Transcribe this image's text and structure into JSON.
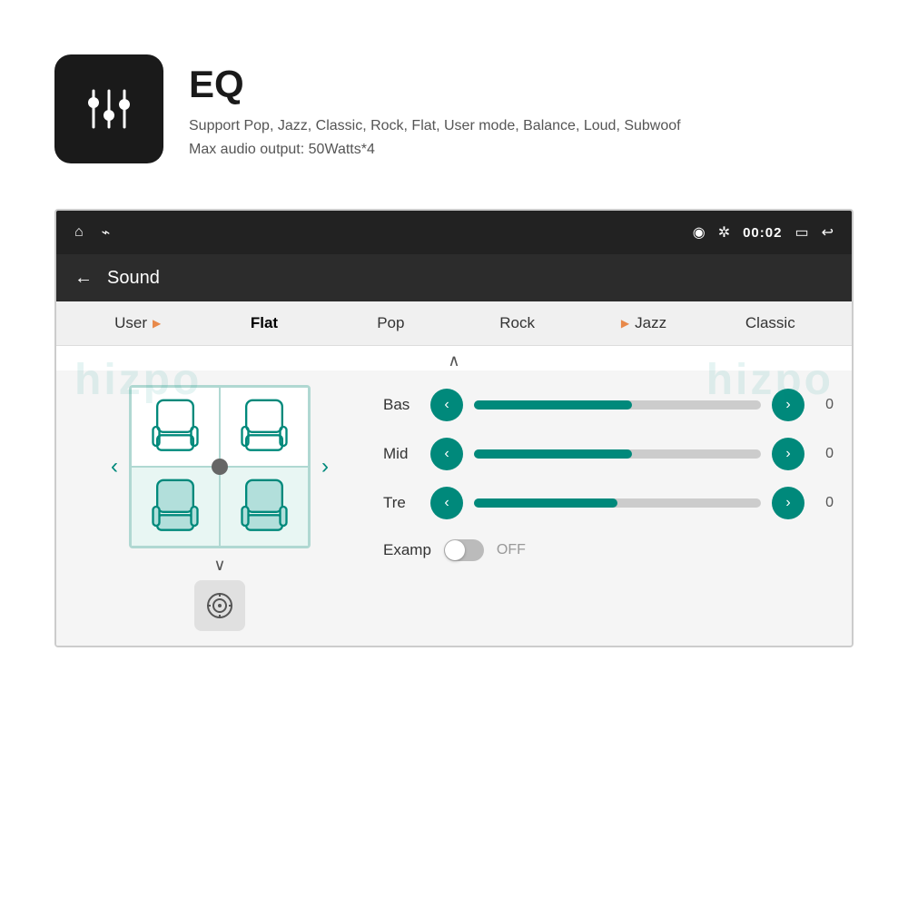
{
  "header": {
    "icon_label": "equalizer-icon",
    "title": "EQ",
    "description_line1": "Support Pop, Jazz, Classic, Rock, Flat, User mode, Balance, Loud, Subwoof",
    "description_line2": "Max audio output: 50Watts*4"
  },
  "status_bar": {
    "left_icons": [
      "home-icon",
      "usb-icon"
    ],
    "right_icons": [
      "location-icon",
      "bluetooth-icon"
    ],
    "time": "00:02",
    "battery_icon": "battery-icon",
    "back_icon": "back-icon"
  },
  "sound_header": {
    "back_label": "←",
    "title": "Sound"
  },
  "eq_modes": [
    {
      "label": "User",
      "active": false,
      "has_arrow": true
    },
    {
      "label": "Flat",
      "active": true,
      "has_arrow": false
    },
    {
      "label": "Pop",
      "active": false,
      "has_arrow": false
    },
    {
      "label": "Rock",
      "active": false,
      "has_arrow": false
    },
    {
      "label": "Jazz",
      "active": false,
      "has_arrow": true
    },
    {
      "label": "Classic",
      "active": false,
      "has_arrow": false
    }
  ],
  "sliders": [
    {
      "label": "Bas",
      "value": 0,
      "fill_percent": 55
    },
    {
      "label": "Mid",
      "value": 0,
      "fill_percent": 55
    },
    {
      "label": "Tre",
      "value": 0,
      "fill_percent": 50
    }
  ],
  "examp": {
    "label": "Examp",
    "state": "OFF",
    "enabled": false
  },
  "speaker_layout": {
    "seats": [
      "front-left",
      "front-right",
      "rear-left",
      "rear-right"
    ],
    "active_seats": [
      "rear-left",
      "rear-right"
    ]
  },
  "watermarks": [
    "hizpo",
    "hizpo"
  ],
  "buttons": {
    "left_arrow": "‹",
    "right_arrow": "›",
    "chevron_up": "∧",
    "chevron_down": "∨"
  }
}
